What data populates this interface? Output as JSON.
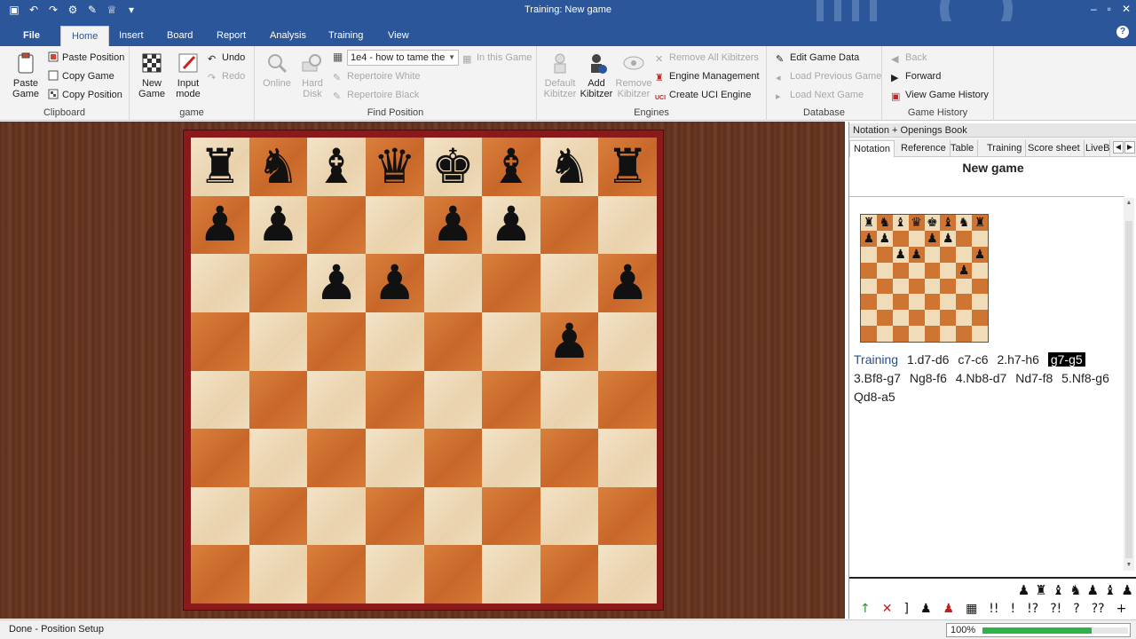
{
  "window": {
    "title": "Training: New game",
    "quick_access_icons": [
      "save-icon",
      "undo-icon",
      "redo-icon",
      "settings-icon",
      "tools-icon",
      "trophy-icon",
      "dropdown-icon"
    ],
    "controls": [
      "–",
      "▫",
      "✕"
    ]
  },
  "ribbon": {
    "tabs": [
      "File",
      "Home",
      "Insert",
      "Board",
      "Report",
      "Analysis",
      "Training",
      "View"
    ],
    "active_tab": "Home",
    "help_glyph": "?",
    "groups": {
      "clipboard": {
        "label": "Clipboard",
        "paste_game": "Paste Game",
        "paste_position": "Paste Position",
        "copy_game": "Copy Game",
        "copy_position": "Copy Position"
      },
      "game": {
        "label": "game",
        "new_game": "New Game",
        "input_mode": "Input mode",
        "undo": "Undo",
        "redo": "Redo"
      },
      "find_position": {
        "label": "Find Position",
        "online": "Online",
        "hard_disk": "Hard Disk",
        "combo_value": "1e4 - how to tame the",
        "in_this_game": "In this Game",
        "repertoire_white": "Repertoire White",
        "repertoire_black": "Repertoire Black"
      },
      "engines": {
        "label": "Engines",
        "default_kibitzer": "Default Kibitzer",
        "add_kibitzer": "Add Kibitzer",
        "remove_kibitzer": "Remove Kibitzer",
        "remove_all_kibitzers": "Remove All Kibitzers",
        "engine_management": "Engine Management",
        "create_uci_engine": "Create UCI Engine"
      },
      "database": {
        "label": "Database",
        "edit_game_data": "Edit Game Data",
        "load_previous_game": "Load Previous Game",
        "load_next_game": "Load Next Game"
      },
      "game_history": {
        "label": "Game History",
        "back": "Back",
        "forward": "Forward",
        "view_game_history": "View Game History"
      }
    }
  },
  "board": {
    "ranks": [
      [
        "♜",
        "♞",
        "♝",
        "♛",
        "♚",
        "♝",
        "♞",
        "♜"
      ],
      [
        "♟",
        "♟",
        "",
        "",
        "♟",
        "♟",
        "",
        ""
      ],
      [
        "",
        "",
        "♟",
        "♟",
        "",
        "",
        "",
        "♟"
      ],
      [
        "",
        "",
        "",
        "",
        "",
        "",
        "♟",
        ""
      ],
      [
        "",
        "",
        "",
        "",
        "",
        "",
        "",
        ""
      ],
      [
        "",
        "",
        "",
        "",
        "",
        "",
        "",
        ""
      ],
      [
        "",
        "",
        "",
        "",
        "",
        "",
        "",
        ""
      ],
      [
        "",
        "",
        "",
        "",
        "",
        "",
        "",
        ""
      ]
    ]
  },
  "panel": {
    "header": "Notation + Openings Book",
    "tabs": [
      "Notation",
      "Reference",
      "Table",
      "Training",
      "Score sheet",
      "LiveBo"
    ],
    "active_tab": "Notation",
    "game_title": "New game",
    "notation": [
      {
        "text": "Training",
        "style": "label"
      },
      {
        "text": "1.d7-d6",
        "style": ""
      },
      {
        "text": "c7-c6",
        "style": ""
      },
      {
        "text": "2.h7-h6",
        "style": ""
      },
      {
        "text": "g7-g5",
        "style": "hl"
      },
      {
        "text": "3.Bf8-g7",
        "style": ""
      },
      {
        "text": "Ng8-f6",
        "style": ""
      },
      {
        "text": "4.Nb8-d7",
        "style": ""
      },
      {
        "text": "Nd7-f8",
        "style": ""
      },
      {
        "text": "5.Nf8-g6",
        "style": ""
      },
      {
        "text": "Qd8-a5",
        "style": ""
      }
    ],
    "piece_toolbar": [
      "♟",
      "♜",
      "♝",
      "♞",
      "♟",
      "♝",
      "♟"
    ],
    "annotation_toolbar": [
      "↑",
      "✕",
      "]",
      "♟",
      "♟",
      "▦",
      "!!",
      "!",
      "!?",
      "?!",
      "?",
      "??",
      "+"
    ]
  },
  "status": {
    "text": "Done - Position Setup",
    "zoom_label": "100%",
    "zoom_fraction": 0.75
  },
  "colors": {
    "accent": "#2b579a",
    "board_dark": "#c8672a",
    "board_light": "#f0ddbd",
    "frame": "#8a1a1a",
    "zoom_fill": "#2fb24a"
  }
}
